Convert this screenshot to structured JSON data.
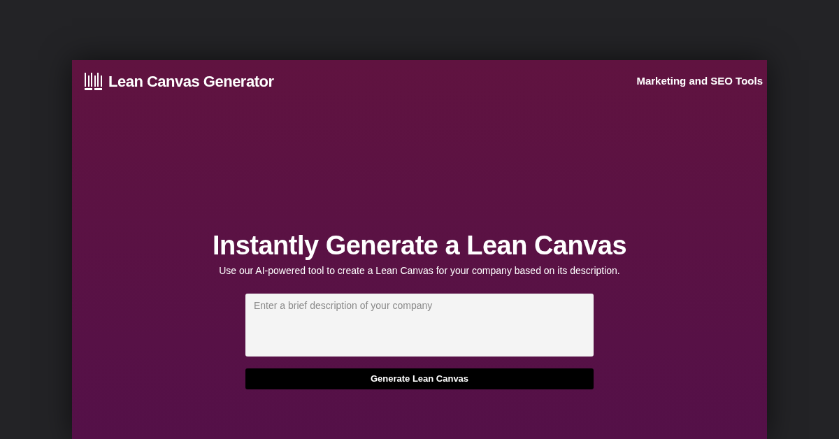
{
  "header": {
    "logo": "Lean Canvas Generator",
    "nav_link": "Marketing and SEO Tools"
  },
  "hero": {
    "title": "Instantly Generate a Lean Canvas",
    "subtitle": "Use our AI-powered tool to create a Lean Canvas for your company based on its description.",
    "description_field": {
      "placeholder": "Enter a brief description of your company"
    },
    "button": "Generate Lean Canvas"
  }
}
